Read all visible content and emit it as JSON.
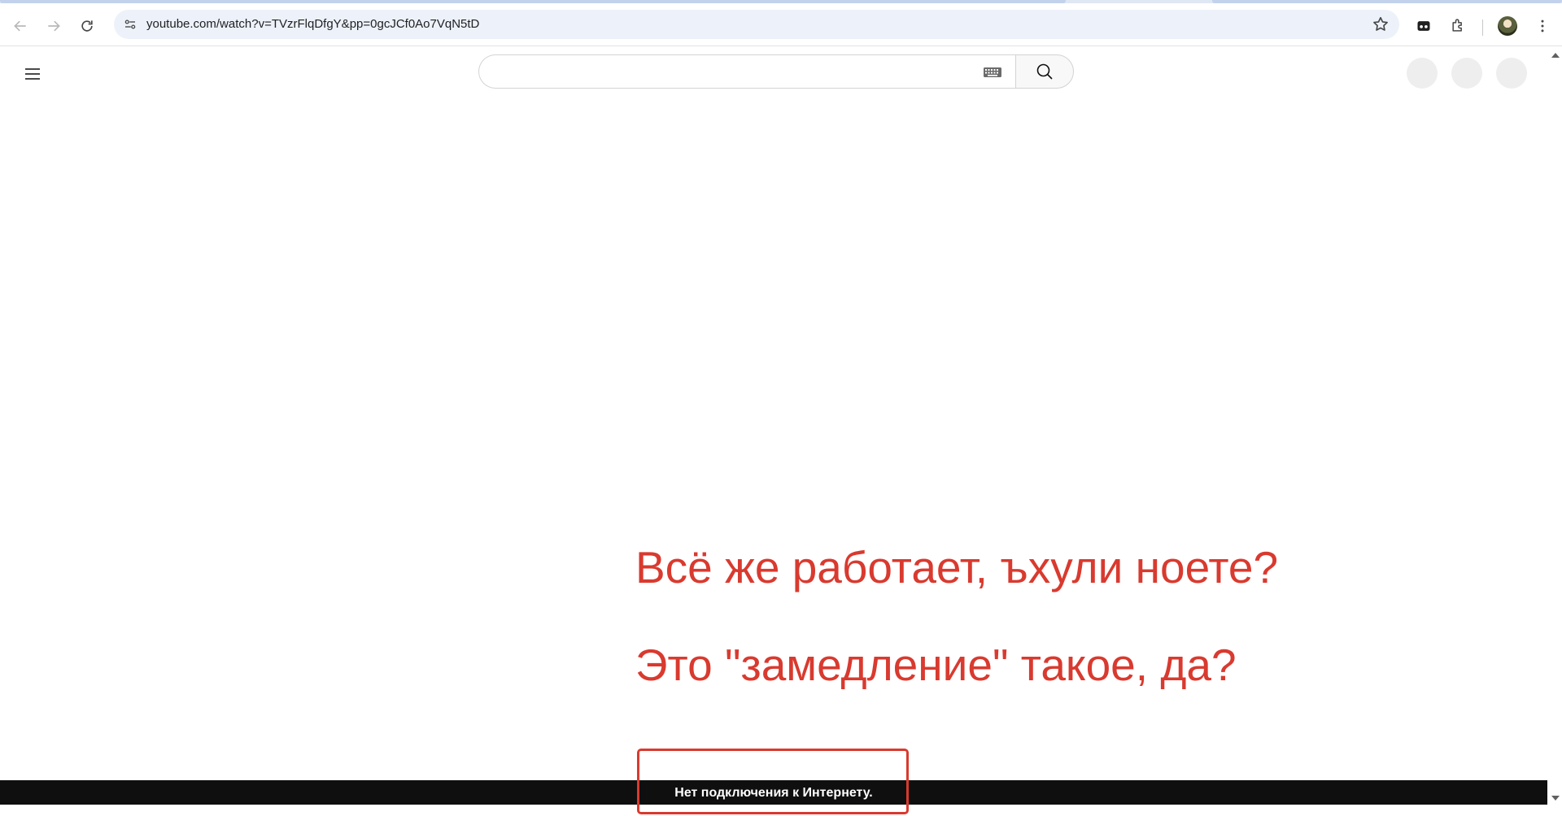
{
  "browser": {
    "url": "youtube.com/watch?v=TVzrFlqDfgY&pp=0gcJCf0Ao7VqN5tD",
    "icons": [
      "back-icon",
      "forward-icon",
      "reload-icon",
      "site-settings-icon",
      "bookmark-star-icon",
      "incognito-icon",
      "extensions-icon",
      "profile-avatar",
      "more-menu-icon"
    ]
  },
  "youtube": {
    "search": {
      "value": "",
      "placeholder": ""
    },
    "icons": [
      "menu-icon",
      "keyboard-icon",
      "search-icon"
    ]
  },
  "overlay": {
    "line1": "Всё же работает, ъхули ноете?",
    "line2": "Это \"замедление\" такое, да?"
  },
  "offline": {
    "message": "Нет подключения к Интернету."
  },
  "colors": {
    "accent_red": "#d93a2f",
    "offline_bg": "#0f0f0f"
  }
}
